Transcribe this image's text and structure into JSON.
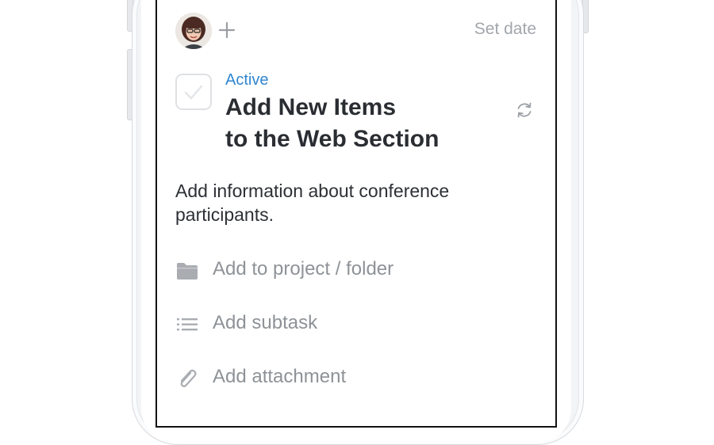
{
  "header": {
    "set_date_label": "Set date"
  },
  "task": {
    "status": "Active",
    "title_line1": "Add New Items",
    "title_line2": "to the Web Section",
    "description_line1": "Add information about conference",
    "description_line2": "participants."
  },
  "actions": [
    {
      "label": "Add to project / folder",
      "icon": "folder-icon"
    },
    {
      "label": "Add subtask",
      "icon": "list-icon"
    },
    {
      "label": "Add attachment",
      "icon": "paperclip-icon"
    }
  ],
  "colors": {
    "accent": "#2f86d0",
    "muted_text": "#8e9297",
    "title_text": "#2a2d32"
  }
}
